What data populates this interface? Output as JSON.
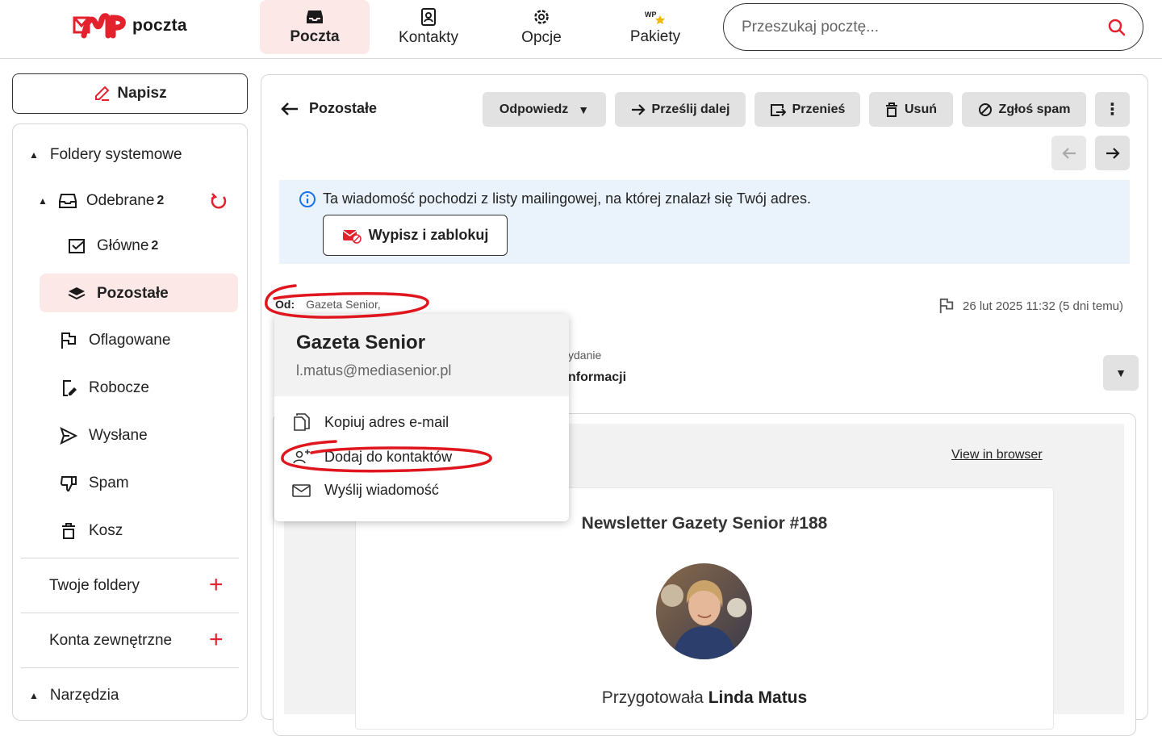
{
  "header": {
    "logo_text": "poczta",
    "tabs": [
      {
        "label": "Poczta",
        "icon": "inbox-icon",
        "active": true
      },
      {
        "label": "Kontakty",
        "icon": "contacts-icon"
      },
      {
        "label": "Opcje",
        "icon": "gear-icon"
      },
      {
        "label": "Pakiety",
        "icon": "packages-icon"
      }
    ],
    "search_placeholder": "Przeszukaj pocztę..."
  },
  "sidebar": {
    "compose_label": "Napisz",
    "system_folders_label": "Foldery systemowe",
    "inbox": {
      "label": "Odebrane",
      "count": "2"
    },
    "items": [
      {
        "label": "Główne",
        "count": "2",
        "icon": "checkbox-mail-icon"
      },
      {
        "label": "Pozostałe",
        "icon": "layers-icon",
        "active": true
      },
      {
        "label": "Oflagowane",
        "icon": "flag-icon"
      },
      {
        "label": "Robocze",
        "icon": "draft-icon"
      },
      {
        "label": "Wysłane",
        "icon": "send-icon"
      },
      {
        "label": "Spam",
        "icon": "thumbs-down-icon"
      },
      {
        "label": "Kosz",
        "icon": "trash-icon"
      }
    ],
    "your_folders_label": "Twoje foldery",
    "external_accounts_label": "Konta zewnętrzne",
    "tools_label": "Narzędzia"
  },
  "toolbar": {
    "back_label": "Pozostałe",
    "reply_label": "Odpowiedz",
    "forward_label": "Prześlij dalej",
    "move_label": "Przenieś",
    "delete_label": "Usuń",
    "spam_label": "Zgłoś spam"
  },
  "message": {
    "info_text": "Ta wiadomość pochodzi z listy mailingowej, na której znalazł się Twój adres.",
    "unsubscribe_label": "Wypisz i zablokuj",
    "from_label": "Od:",
    "from_name": "Gazeta Senior,",
    "date": "26 lut 2025 11:32 (5 dni temu)",
    "subject_small": "ydanie",
    "subject_big": "nformacji",
    "view_in_browser": "View in browser",
    "newsletter_title": "Newsletter Gazety Senior #188",
    "prepared_prefix": "Przygotowała ",
    "prepared_name": "Linda Matus"
  },
  "popup": {
    "name": "Gazeta Senior",
    "email": "l.matus@mediasenior.pl",
    "items": [
      {
        "label": "Kopiuj adres e-mail",
        "icon": "copy-icon"
      },
      {
        "label": "Dodaj do kontaktów",
        "icon": "add-contact-icon"
      },
      {
        "label": "Wyślij wiadomość",
        "icon": "envelope-icon"
      }
    ]
  },
  "colors": {
    "brand_red": "#e4222e",
    "active_bg": "#fde8e8",
    "button_gray": "#e2e2e2",
    "info_bg": "#eaf3fc",
    "info_icon": "#1a73e8",
    "annotation": "#e0161e"
  }
}
